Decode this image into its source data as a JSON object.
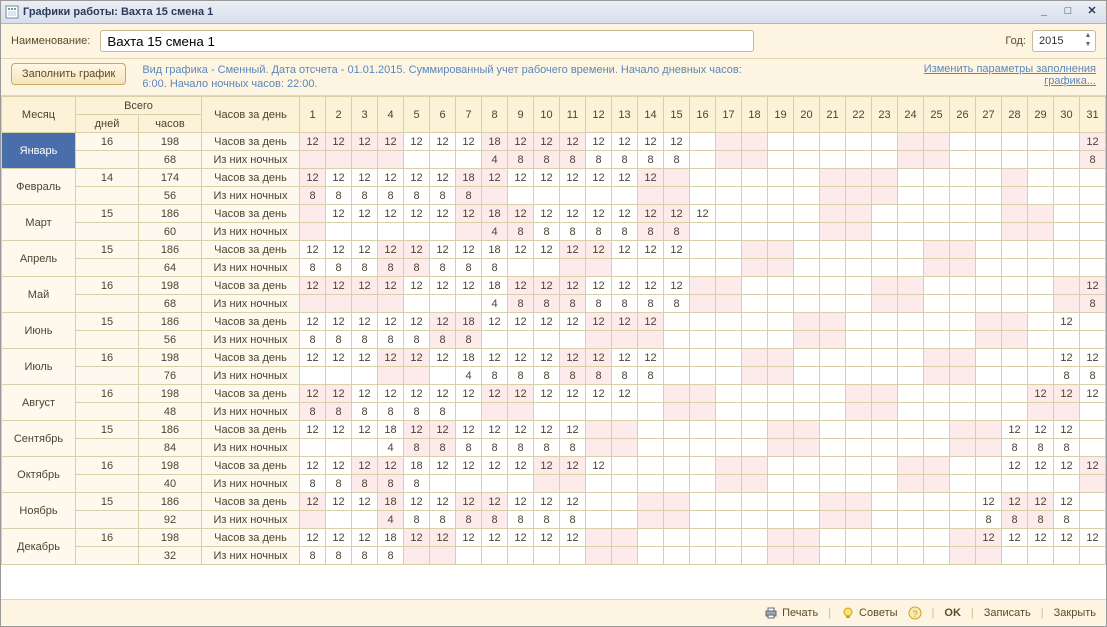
{
  "window": {
    "title": "Графики работы: Вахта 15 смена 1"
  },
  "labels": {
    "name": "Наименование:",
    "year": "Год:"
  },
  "name_value": "Вахта 15 смена 1",
  "year_value": "2015",
  "fill_button": "Заполнить график",
  "info_line1": "Вид графика - Сменный. Дата отсчета - 01.01.2015. Суммированный учет рабочего времени. Начало дневных часов:",
  "info_line2": "6:00. Начало ночных часов: 22:00.",
  "edit_link_l1": "Изменить параметры заполнения",
  "edit_link_l2": "графика...",
  "headers": {
    "month": "Месяц",
    "total": "Всего",
    "per_day": "Часов за день",
    "days": "дней",
    "hours": "часов"
  },
  "row_labels": {
    "hours": "Часов за день",
    "night": "Из них ночных"
  },
  "footer": {
    "print": "Печать",
    "tips": "Советы",
    "ok": "OK",
    "save": "Записать",
    "close": "Закрыть"
  },
  "days": [
    1,
    2,
    3,
    4,
    5,
    6,
    7,
    8,
    9,
    10,
    11,
    12,
    13,
    14,
    15,
    16,
    17,
    18,
    19,
    20,
    21,
    22,
    23,
    24,
    25,
    26,
    27,
    28,
    29,
    30,
    31
  ],
  "weekend_sets": {
    "1": [
      1,
      2,
      3,
      4,
      8,
      9,
      10,
      11,
      17,
      18,
      24,
      25,
      31
    ],
    "2": [
      1,
      7,
      8,
      14,
      15,
      21,
      22,
      23,
      28
    ],
    "3": [
      1,
      7,
      8,
      9,
      14,
      15,
      21,
      22,
      28,
      29
    ],
    "4": [
      4,
      5,
      11,
      12,
      18,
      19,
      25,
      26
    ],
    "5": [
      1,
      2,
      3,
      4,
      9,
      10,
      11,
      16,
      17,
      23,
      24,
      30,
      31
    ],
    "6": [
      6,
      7,
      12,
      13,
      14,
      20,
      21,
      27,
      28
    ],
    "7": [
      4,
      5,
      11,
      12,
      18,
      19,
      25,
      26
    ],
    "8": [
      1,
      2,
      8,
      9,
      15,
      16,
      22,
      23,
      29,
      30
    ],
    "9": [
      5,
      6,
      12,
      13,
      19,
      20,
      26,
      27
    ],
    "10": [
      3,
      4,
      10,
      11,
      17,
      18,
      24,
      25,
      31
    ],
    "11": [
      1,
      4,
      7,
      8,
      14,
      15,
      21,
      22,
      28,
      29
    ],
    "12": [
      5,
      6,
      12,
      13,
      19,
      20,
      26,
      27
    ]
  },
  "months": [
    {
      "n": 1,
      "name": "Январь",
      "days": 16,
      "hours": 198,
      "night": 68,
      "h": {
        "1": 12,
        "2": 12,
        "3": 12,
        "4": 12,
        "5": 12,
        "6": 12,
        "7": 12,
        "8": 18,
        "9": 12,
        "10": 12,
        "11": 12,
        "12": 12,
        "13": 12,
        "14": 12,
        "15": 12,
        "31": 12
      },
      "ni": {
        "8": 4,
        "9": 8,
        "10": 8,
        "11": 8,
        "12": 8,
        "13": 8,
        "14": 8,
        "15": 8,
        "31": 8
      }
    },
    {
      "n": 2,
      "name": "Февраль",
      "days": 14,
      "hours": 174,
      "night": 56,
      "h": {
        "1": 12,
        "2": 12,
        "3": 12,
        "4": 12,
        "5": 12,
        "6": 12,
        "7": 18,
        "8": 12,
        "9": 12,
        "10": 12,
        "11": 12,
        "12": 12,
        "13": 12,
        "14": 12
      },
      "ni": {
        "1": 8,
        "2": 8,
        "3": 8,
        "4": 8,
        "5": 8,
        "6": 8,
        "7": 8
      }
    },
    {
      "n": 3,
      "name": "Март",
      "days": 15,
      "hours": 186,
      "night": 60,
      "h": {
        "2": 12,
        "3": 12,
        "4": 12,
        "5": 12,
        "6": 12,
        "7": 12,
        "8": 18,
        "9": 12,
        "10": 12,
        "11": 12,
        "12": 12,
        "13": 12,
        "14": 12,
        "15": 12,
        "16": 12
      },
      "ni": {
        "8": 4,
        "9": 8,
        "10": 8,
        "11": 8,
        "12": 8,
        "13": 8,
        "14": 8,
        "15": 8
      }
    },
    {
      "n": 4,
      "name": "Апрель",
      "days": 15,
      "hours": 186,
      "night": 64,
      "h": {
        "1": 12,
        "2": 12,
        "3": 12,
        "4": 12,
        "5": 12,
        "6": 12,
        "7": 12,
        "8": 18,
        "9": 12,
        "10": 12,
        "11": 12,
        "12": 12,
        "13": 12,
        "14": 12,
        "15": 12
      },
      "ni": {
        "1": 8,
        "2": 8,
        "3": 8,
        "4": 8,
        "5": 8,
        "6": 8,
        "7": 8,
        "8": 8
      }
    },
    {
      "n": 5,
      "name": "Май",
      "days": 16,
      "hours": 198,
      "night": 68,
      "h": {
        "1": 12,
        "2": 12,
        "3": 12,
        "4": 12,
        "5": 12,
        "6": 12,
        "7": 12,
        "8": 18,
        "9": 12,
        "10": 12,
        "11": 12,
        "12": 12,
        "13": 12,
        "14": 12,
        "15": 12,
        "31": 12
      },
      "ni": {
        "8": 4,
        "9": 8,
        "10": 8,
        "11": 8,
        "12": 8,
        "13": 8,
        "14": 8,
        "15": 8,
        "31": 8
      }
    },
    {
      "n": 6,
      "name": "Июнь",
      "days": 15,
      "hours": 186,
      "night": 56,
      "h": {
        "1": 12,
        "2": 12,
        "3": 12,
        "4": 12,
        "5": 12,
        "6": 12,
        "7": 18,
        "8": 12,
        "9": 12,
        "10": 12,
        "11": 12,
        "12": 12,
        "13": 12,
        "14": 12,
        "30": 12
      },
      "ni": {
        "1": 8,
        "2": 8,
        "3": 8,
        "4": 8,
        "5": 8,
        "6": 8,
        "7": 8
      }
    },
    {
      "n": 7,
      "name": "Июль",
      "days": 16,
      "hours": 198,
      "night": 76,
      "h": {
        "1": 12,
        "2": 12,
        "3": 12,
        "4": 12,
        "5": 12,
        "6": 12,
        "7": 18,
        "8": 12,
        "9": 12,
        "10": 12,
        "11": 12,
        "12": 12,
        "13": 12,
        "14": 12,
        "30": 12,
        "31": 12
      },
      "ni": {
        "7": 4,
        "8": 8,
        "9": 8,
        "10": 8,
        "11": 8,
        "12": 8,
        "13": 8,
        "14": 8,
        "30": 8,
        "31": 8
      }
    },
    {
      "n": 8,
      "name": "Август",
      "days": 16,
      "hours": 198,
      "night": 48,
      "h": {
        "1": 12,
        "2": 12,
        "3": 12,
        "4": 12,
        "5": 12,
        "6": 12,
        "7": 12,
        "8": 12,
        "9": 12,
        "10": 12,
        "11": 12,
        "12": 12,
        "13": 12,
        "29": 12,
        "30": 12,
        "31": 12
      },
      "ni": {
        "1": 8,
        "2": 8,
        "3": 8,
        "4": 8,
        "5": 8,
        "6": 8
      }
    },
    {
      "n": 9,
      "name": "Сентябрь",
      "days": 15,
      "hours": 186,
      "night": 84,
      "h": {
        "1": 12,
        "2": 12,
        "3": 12,
        "4": 18,
        "5": 12,
        "6": 12,
        "7": 12,
        "8": 12,
        "9": 12,
        "10": 12,
        "11": 12,
        "28": 12,
        "29": 12,
        "30": 12
      },
      "ni": {
        "4": 4,
        "5": 8,
        "6": 8,
        "7": 8,
        "8": 8,
        "9": 8,
        "10": 8,
        "11": 8,
        "28": 8,
        "29": 8,
        "30": 8
      }
    },
    {
      "n": 10,
      "name": "Октябрь",
      "days": 16,
      "hours": 198,
      "night": 40,
      "h": {
        "1": 12,
        "2": 12,
        "3": 12,
        "4": 12,
        "5": 18,
        "6": 12,
        "7": 12,
        "8": 12,
        "9": 12,
        "10": 12,
        "11": 12,
        "12": 12,
        "28": 12,
        "29": 12,
        "30": 12,
        "31": 12
      },
      "ni": {
        "1": 8,
        "2": 8,
        "3": 8,
        "4": 8,
        "5": 8
      }
    },
    {
      "n": 11,
      "name": "Ноябрь",
      "days": 15,
      "hours": 186,
      "night": 92,
      "h": {
        "1": 12,
        "2": 12,
        "3": 12,
        "4": 18,
        "5": 12,
        "6": 12,
        "7": 12,
        "8": 12,
        "9": 12,
        "10": 12,
        "11": 12,
        "27": 12,
        "28": 12,
        "29": 12,
        "30": 12
      },
      "ni": {
        "4": 4,
        "5": 8,
        "6": 8,
        "7": 8,
        "8": 8,
        "9": 8,
        "10": 8,
        "11": 8,
        "27": 8,
        "28": 8,
        "29": 8,
        "30": 8
      }
    },
    {
      "n": 12,
      "name": "Декабрь",
      "days": 16,
      "hours": 198,
      "night": 32,
      "h": {
        "1": 12,
        "2": 12,
        "3": 12,
        "4": 18,
        "5": 12,
        "6": 12,
        "7": 12,
        "8": 12,
        "9": 12,
        "10": 12,
        "11": 12,
        "27": 12,
        "28": 12,
        "29": 12,
        "30": 12,
        "31": 12
      },
      "ni": {
        "1": 8,
        "2": 8,
        "3": 8,
        "4": 8
      }
    }
  ]
}
